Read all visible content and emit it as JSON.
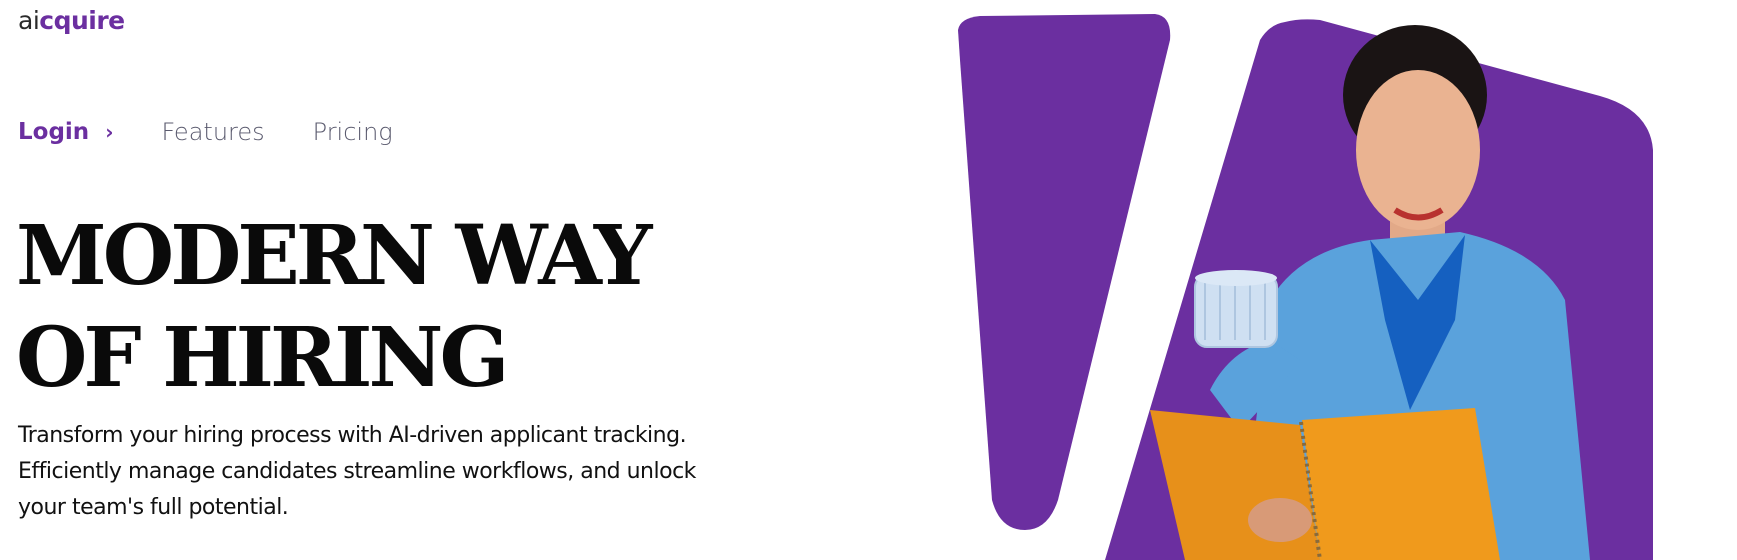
{
  "brand": {
    "prefix": "ai",
    "suffix": "cquire"
  },
  "nav": {
    "login": "Login",
    "login_chevron": "›",
    "features": "Features",
    "pricing": "Pricing"
  },
  "hero": {
    "headline_line1": "MODERN WAY",
    "headline_line2": "OF HIRING",
    "subtext": "Transform your hiring process with AI-driven applicant tracking. Efficiently manage candidates streamline workflows, and unlock your team's full potential."
  },
  "colors": {
    "accent": "#6b2fa0",
    "text": "#0a0a0a"
  }
}
